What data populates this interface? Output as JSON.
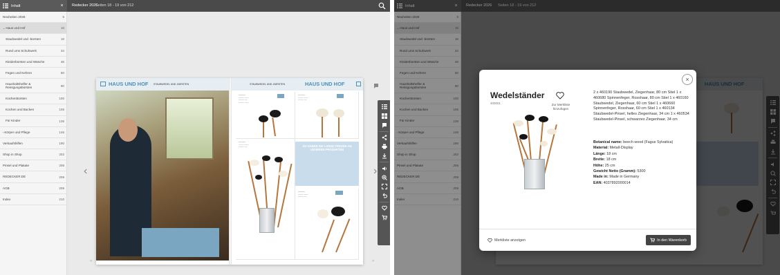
{
  "colors": {
    "topbar": "#4a4a4a",
    "accent": "#4c8fb3",
    "panel": "#7aa6c2",
    "toolbar": "#555555"
  },
  "topbar": {
    "menu_label": "Inhalt",
    "close_symbol": "×",
    "catalog_title": "Redecker 2026",
    "pages_label": "Seiten 18 - 19 von 212",
    "search_icon": "search-icon"
  },
  "sidebar": {
    "items": [
      {
        "label": "Neuheiten 2026",
        "page": "5"
      },
      {
        "label": "Haus und Hof",
        "page": "18"
      },
      {
        "label": "Staubwedel und -bürsten",
        "page": "18"
      },
      {
        "label": "Rund ums Schuhwerk",
        "page": "34"
      },
      {
        "label": "Kleiderbürsten und Wäsche",
        "page": "48"
      },
      {
        "label": "Fegen und Kehren",
        "page": "60"
      },
      {
        "label": "Haushaltshelfer & Reinigungsbürsten",
        "page": "90"
      },
      {
        "label": "Küchenbürsten",
        "page": "100"
      },
      {
        "label": "Kochen und Backen",
        "page": "106"
      },
      {
        "label": "Für Kinder",
        "page": "136"
      },
      {
        "label": "Körper und Pflege",
        "page": "146"
      },
      {
        "label": "Verkaufshilfen",
        "page": "190"
      },
      {
        "label": "Shop in Shop",
        "page": "202"
      },
      {
        "label": "Pinsel und Plakate",
        "page": "206"
      },
      {
        "label": "REDECKER.DE",
        "page": "209"
      },
      {
        "label": "AGB",
        "page": "209"
      },
      {
        "label": "Index",
        "page": "210"
      }
    ]
  },
  "spread": {
    "header_title": "HAUS UND HOF",
    "header_subtitle": "STAUBWEDEL UND -BÜRSTEN",
    "right_header_subtitle": "STAUBWEDEL UND -BÜRSTEN",
    "panel_text": "SO HABEN SIE LANGE FREUDE AN UNSEREN PRODUKTEN",
    "badge_text": "RAUMDUFTWEDEL"
  },
  "modal": {
    "title": "Wedelständer",
    "code": "400001",
    "favorite_label": "Zur Merkliste hinzufügen",
    "description": "2 x 460190 Staubwedel, Ziegenhaar, 80 cm Stiel 1 x 460680 Spinnenfeger, Rosshaar, 80 cm Stiel 1 x 460160 Staubwedel, Ziegenhaar, 60 cm Stiel 1 x 460660 Spinnenfeger, Rosshaar, 60 cm Stiel 1 x 460134 Staubwedel-Pinsel, helles Ziegenhaar, 34 cm 1 x 460534 Staubwedel-Pinsel, schwarzes Ziegenhaar, 34 cm",
    "specs": [
      {
        "key": "Botanical name:",
        "value": "beech wood (Fagus Sylvatica)"
      },
      {
        "key": "Material:",
        "value": "Metall-Display"
      },
      {
        "key": "Länge:",
        "value": "18 cm"
      },
      {
        "key": "Breite:",
        "value": "18 cm"
      },
      {
        "key": "Höhe:",
        "value": "25 cm"
      },
      {
        "key": "Gewicht Netto (Gramm):",
        "value": "5300"
      },
      {
        "key": "Made in:",
        "value": "Made in Germany"
      },
      {
        "key": "EAN:",
        "value": "4037892000014"
      }
    ],
    "wishlist_label": "Merkliste anzeigen",
    "cart_label": "In den Warenkorb"
  }
}
